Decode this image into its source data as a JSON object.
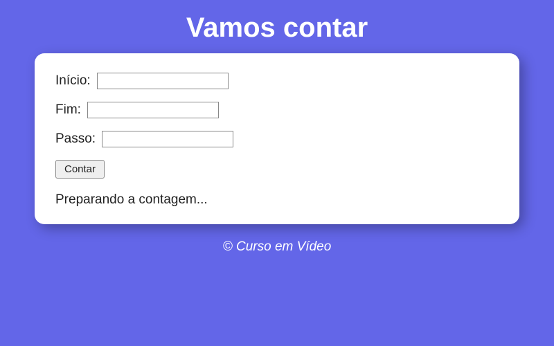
{
  "header": {
    "title": "Vamos contar"
  },
  "form": {
    "inicio": {
      "label": "Início:",
      "value": ""
    },
    "fim": {
      "label": "Fim:",
      "value": ""
    },
    "passo": {
      "label": "Passo:",
      "value": ""
    },
    "submit_label": "Contar"
  },
  "result": {
    "text": "Preparando a contagem..."
  },
  "footer": {
    "text": "© Curso em Vídeo"
  }
}
